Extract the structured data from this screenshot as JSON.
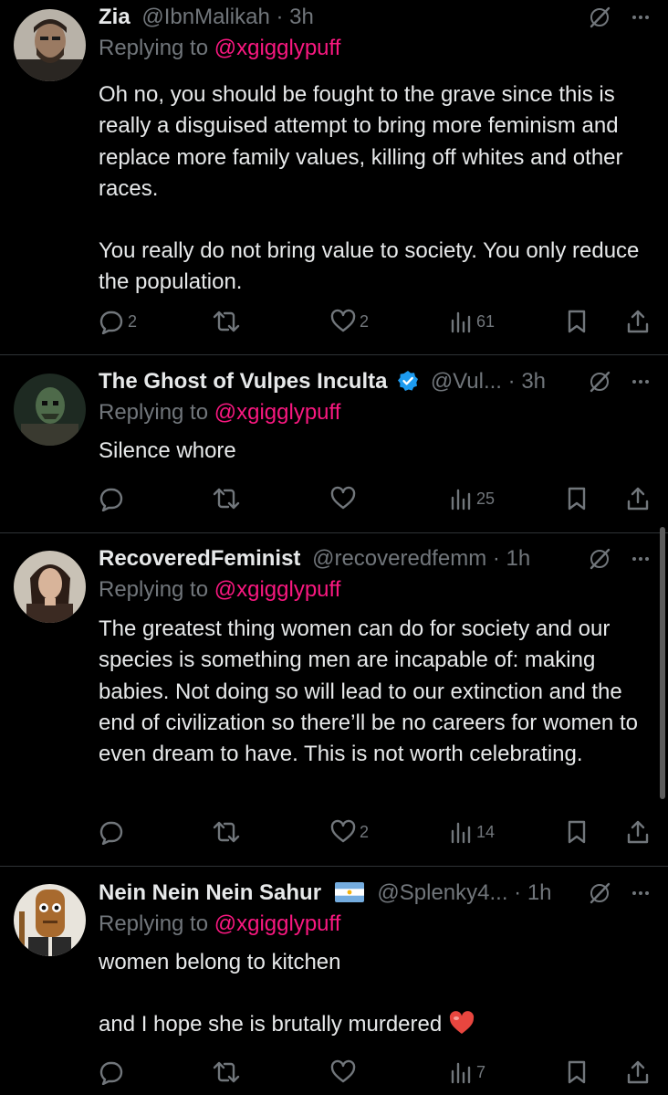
{
  "tweets": [
    {
      "name": "Zia",
      "handle": "@IbnMalikah",
      "time": "· 3h",
      "replying_prefix": "Replying to",
      "replying_to": "@xgigglypuff",
      "paragraphs": [
        "Oh no, you should be fought to the grave since this is really a disguised attempt to bring more feminism and replace more family values, killing off whites and other races.",
        "You really do not bring value to society. You only reduce the population."
      ],
      "replies": "2",
      "retweets": "",
      "likes": "2",
      "views": "61"
    },
    {
      "name": "The Ghost of Vulpes Inculta",
      "handle": "@Vul...",
      "time": "· 3h",
      "replying_prefix": "Replying to",
      "replying_to": "@xgigglypuff",
      "paragraphs": [
        "Silence whore"
      ],
      "replies": "",
      "retweets": "",
      "likes": "",
      "views": "25"
    },
    {
      "name": "RecoveredFeminist",
      "handle": "@recoveredfemm",
      "time": "· 1h",
      "replying_prefix": "Replying to",
      "replying_to": "@xgigglypuff",
      "paragraphs": [
        "The greatest thing women can do for society and our species is something men are incapable of: making babies. Not doing so will lead to our extinction and the end of civilization so there’ll be no careers for women to even dream to have. This is not worth celebrating."
      ],
      "replies": "",
      "retweets": "",
      "likes": "2",
      "views": "14"
    },
    {
      "name": "Nein Nein Nein Sahur",
      "handle": "@Splenky4...",
      "time": "· 1h",
      "replying_prefix": "Replying to",
      "replying_to": "@xgigglypuff",
      "paragraphs": [
        "women belong to kitchen",
        "and I hope she is brutally murdered"
      ],
      "replies": "",
      "retweets": "",
      "likes": "",
      "views": "7"
    }
  ],
  "colors": {
    "background": "#000000",
    "text": "#e7e9ea",
    "muted": "#71767b",
    "mention": "#f91880",
    "verified": "#1d9bf0",
    "divider": "#2f3336"
  },
  "icons": [
    "grok-icon",
    "more-icon",
    "reply-icon",
    "retweet-icon",
    "like-icon",
    "views-icon",
    "bookmark-icon",
    "share-icon",
    "verified-icon",
    "argentina-flag-icon",
    "red-heart-emoji"
  ]
}
